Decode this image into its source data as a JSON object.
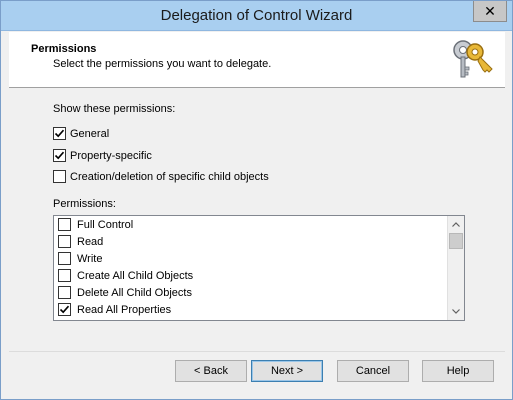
{
  "window": {
    "title": "Delegation of Control Wizard",
    "close_glyph": "✕"
  },
  "header": {
    "title": "Permissions",
    "subtitle": "Select the permissions you want to delegate.",
    "icon": "keys-icon"
  },
  "show_permissions": {
    "label": "Show these permissions:",
    "options": [
      {
        "label": "General",
        "checked": true
      },
      {
        "label": "Property-specific",
        "checked": true
      },
      {
        "label": "Creation/deletion of specific child objects",
        "checked": false
      }
    ]
  },
  "permissions": {
    "label": "Permissions:",
    "items": [
      {
        "label": "Full Control",
        "checked": false
      },
      {
        "label": "Read",
        "checked": false
      },
      {
        "label": "Write",
        "checked": false
      },
      {
        "label": "Create All Child Objects",
        "checked": false
      },
      {
        "label": "Delete All Child Objects",
        "checked": false
      },
      {
        "label": "Read All Properties",
        "checked": true
      }
    ]
  },
  "buttons": {
    "back": "< Back",
    "next": "Next >",
    "cancel": "Cancel",
    "help": "Help"
  }
}
